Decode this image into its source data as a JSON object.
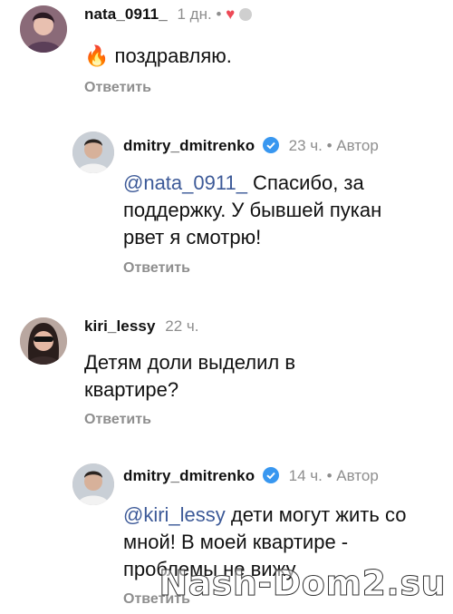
{
  "comments": [
    {
      "username": "nata_0911_",
      "time": "1 дн.",
      "dot": "•",
      "emoji": "🔥",
      "text": "поздравляю.",
      "reply_label": "Ответить"
    },
    {
      "username": "dmitry_dmitrenko",
      "time": "23 ч.",
      "dot": "•",
      "author": "Автор",
      "mention": "@nata_0911_",
      "text": " Спасибо, за поддержку. У бывшей пукан рвет я смотрю!",
      "reply_label": "Ответить"
    },
    {
      "username": "kiri_lessy",
      "time": "22 ч.",
      "text": "Детям доли выделил в квартире?",
      "reply_label": "Ответить"
    },
    {
      "username": "dmitry_dmitrenko",
      "time": "14 ч.",
      "dot": "•",
      "author": "Автор",
      "mention": "@kiri_lessy",
      "text": " дети могут жить со мной! В моей квартире - проблемы не вижу",
      "reply_label": "Ответить"
    }
  ],
  "watermark": "Nash-Dom2.su",
  "colors": {
    "mention": "#3d5a98",
    "meta": "#8e8e8e",
    "heart": "#ed4956",
    "verified": "#3897f0"
  }
}
